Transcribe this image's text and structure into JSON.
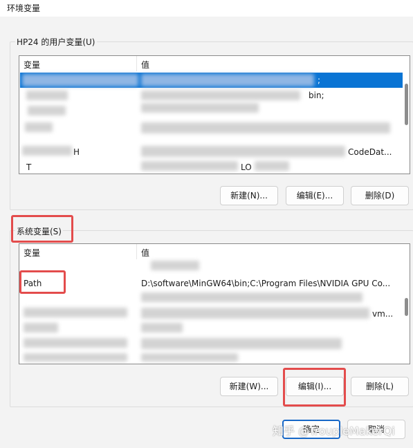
{
  "window": {
    "title": "环境变量"
  },
  "user_vars": {
    "group_label": "HP24 的用户变量(U)",
    "col_variable": "变量",
    "col_value": "值",
    "rows": [
      {
        "name": "",
        "value": ";"
      },
      {
        "name": "",
        "value": "bin;"
      },
      {
        "name": "",
        "value": ""
      },
      {
        "name": "",
        "value": ""
      },
      {
        "name": "H",
        "value": "CodeDat..."
      },
      {
        "name": "T",
        "value": "LO"
      }
    ],
    "buttons": {
      "new": "新建(N)...",
      "edit": "编辑(E)...",
      "delete": "删除(D)"
    }
  },
  "system_vars": {
    "group_label": "系统变量(S)",
    "col_variable": "变量",
    "col_value": "值",
    "rows": [
      {
        "name": "",
        "value": ""
      },
      {
        "name": "Path",
        "value": "D:\\software\\MinGW64\\bin;C:\\Program Files\\NVIDIA GPU Co..."
      },
      {
        "name": "",
        "value": ""
      },
      {
        "name": "",
        "value": "vm..."
      },
      {
        "name": "",
        "value": ""
      },
      {
        "name": "",
        "value": ""
      }
    ],
    "buttons": {
      "new": "新建(W)...",
      "edit": "编辑(I)...",
      "delete": "删除(L)"
    }
  },
  "footer": {
    "ok": "确定",
    "cancel": "取消"
  },
  "watermark": "知乎 @TroupleMakerQi",
  "colors": {
    "selection": "#0a74d4",
    "highlight_box": "#e34c4c",
    "primary_border": "#1667c7"
  }
}
